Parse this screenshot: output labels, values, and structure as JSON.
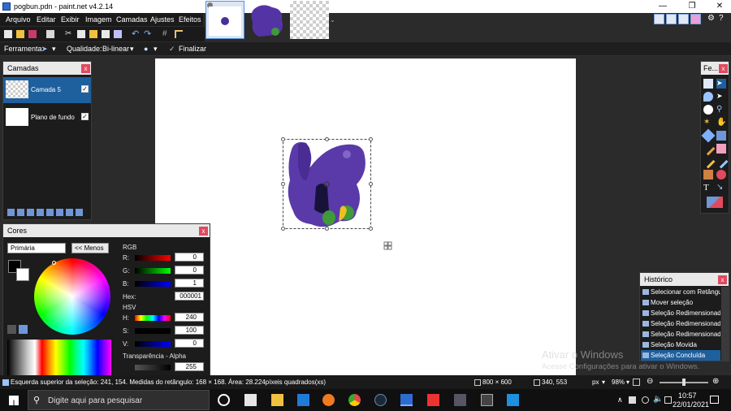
{
  "window": {
    "title": "pogbun.pdn - paint.net v4.2.14",
    "controls": [
      "—",
      "❐",
      "✕"
    ]
  },
  "menu": [
    "Arquivo",
    "Editar",
    "Exibir",
    "Imagem",
    "Camadas",
    "Ajustes",
    "Efeitos"
  ],
  "toolbar": {
    "tool_label": "Ferramenta:",
    "quality_label": "Qualidade:",
    "quality_value": "Bi-linear",
    "finish_label": "Finalizar"
  },
  "layers_panel": {
    "title": "Camadas",
    "layers": [
      {
        "name": "Camada 5",
        "visible": true,
        "selected": true
      },
      {
        "name": "Plano de fundo",
        "visible": true,
        "selected": false
      }
    ]
  },
  "colors_panel": {
    "title": "Cores",
    "mode": "Primária",
    "less_button": "<< Menos",
    "rgb_label": "RGB",
    "hsv_label": "HSV",
    "r_label": "R:",
    "g_label": "G:",
    "b_label": "B:",
    "r": "0",
    "g": "0",
    "b": "1",
    "hex_label": "Hex:",
    "hex": "000001",
    "h_label": "H:",
    "s_label": "S:",
    "v_label": "V:",
    "h": "240",
    "s": "100",
    "v": "0",
    "alpha_label": "Transparência - Alpha",
    "alpha": "255",
    "primary_color": "#000001",
    "secondary_color": "#ffffff"
  },
  "tools_panel": {
    "title": "Fe..."
  },
  "history_panel": {
    "title": "Histórico",
    "items": [
      "Selecionar com Retângulo",
      "Mover seleção",
      "Seleção Redimensionada",
      "Seleção Redimensionada",
      "Seleção Redimensionada",
      "Seleção Movida",
      "Seleção Concluída"
    ],
    "selected_index": 6
  },
  "statusbar": {
    "selection_info": "Esquerda superior da seleção: 241, 154. Medidas do retângulo: 168 × 168. Área: 28.224píxeis quadrados(xs)",
    "image_size": "800 × 600",
    "cursor_pos": "340, 553",
    "units": "px",
    "zoom": "98%"
  },
  "watermark": {
    "line1": "Ativar o Windows",
    "line2": "Acesse Configurações para ativar o Windows."
  },
  "taskbar": {
    "search_placeholder": "Digite aqui para pesquisar",
    "time": "10:57",
    "date": "22/01/2021"
  },
  "colors": {
    "accent": "#1e5f9e",
    "purple": "#5a3aa8",
    "panel_close": "#e04a5f"
  }
}
